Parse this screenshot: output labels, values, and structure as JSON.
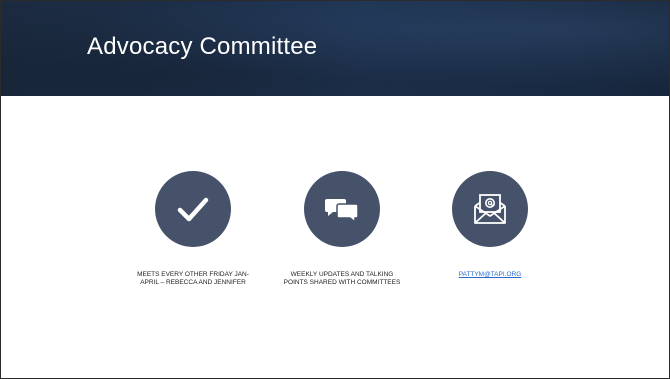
{
  "slide": {
    "title": "Advocacy Committee",
    "items": [
      {
        "icon": "checkmark-icon",
        "caption_line1": "MEETS EVERY OTHER FRIDAY JAN-",
        "caption_line2": "APRIL – REBECCA AND JENNIFER"
      },
      {
        "icon": "chat-bubbles-icon",
        "caption_line1": "WEEKLY UPDATES AND TALKING",
        "caption_line2": "POINTS SHARED WITH COMMITTEES"
      },
      {
        "icon": "envelope-at-icon",
        "caption_line1": "PATTYM@TAPI.ORG"
      }
    ]
  },
  "colors": {
    "title_bar": "#1d3250",
    "icon_circle": "#46526a",
    "link": "#2a6bd1"
  }
}
